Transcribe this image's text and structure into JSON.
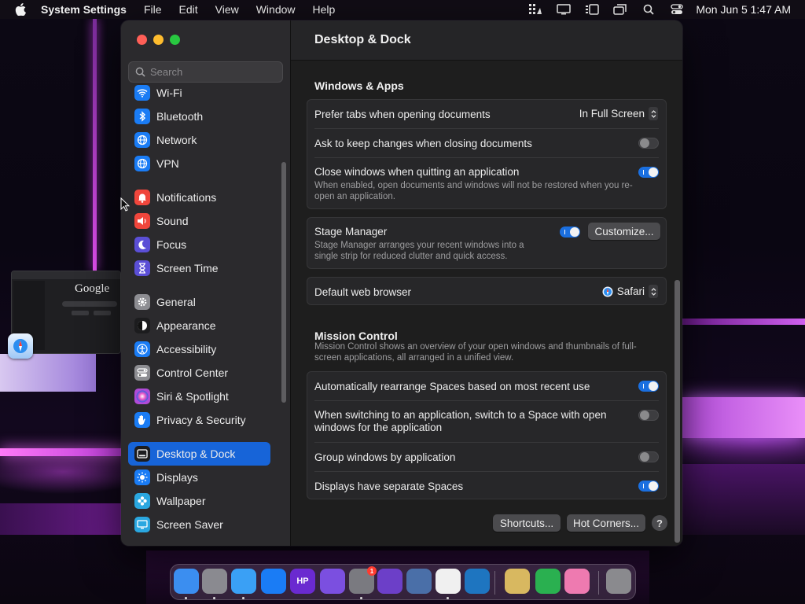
{
  "menubar": {
    "app_name": "System Settings",
    "menus": [
      "File",
      "Edit",
      "View",
      "Window",
      "Help"
    ],
    "clock": "Mon Jun 5  1:47 AM"
  },
  "stage_thumbnail": {
    "label": "Google"
  },
  "window": {
    "search": {
      "placeholder": "Search"
    },
    "sidebar": {
      "items": [
        {
          "label": "Wi-Fi",
          "icon": "wifi-icon",
          "color": "#1a7cf5"
        },
        {
          "label": "Bluetooth",
          "icon": "bluetooth-icon",
          "color": "#1a7cf5"
        },
        {
          "label": "Network",
          "icon": "globe-icon",
          "color": "#1a7cf5"
        },
        {
          "label": "VPN",
          "icon": "globe-icon",
          "color": "#1a7cf5"
        },
        {
          "label": "Notifications",
          "icon": "bell-icon",
          "color": "#f0463c"
        },
        {
          "label": "Sound",
          "icon": "speaker-icon",
          "color": "#f0463c"
        },
        {
          "label": "Focus",
          "icon": "moon-icon",
          "color": "#5b4fd6"
        },
        {
          "label": "Screen Time",
          "icon": "hourglass-icon",
          "color": "#5b4fd6"
        },
        {
          "label": "General",
          "icon": "gear-icon",
          "color": "#8d8d92"
        },
        {
          "label": "Appearance",
          "icon": "appearance-icon",
          "color": "#1c1c1e"
        },
        {
          "label": "Accessibility",
          "icon": "accessibility-icon",
          "color": "#1a7cf5"
        },
        {
          "label": "Control Center",
          "icon": "control-center-icon",
          "color": "#8d8d92"
        },
        {
          "label": "Siri & Spotlight",
          "icon": "siri-icon",
          "color": "#b04bd8"
        },
        {
          "label": "Privacy & Security",
          "icon": "hand-icon",
          "color": "#1a7cf5"
        },
        {
          "label": "Desktop & Dock",
          "icon": "dock-icon",
          "color": "#1c1c1e"
        },
        {
          "label": "Displays",
          "icon": "sun-icon",
          "color": "#1a7cf5"
        },
        {
          "label": "Wallpaper",
          "icon": "flower-icon",
          "color": "#2aa7e0"
        },
        {
          "label": "Screen Saver",
          "icon": "screen-saver-icon",
          "color": "#2aa7e0"
        }
      ],
      "active": "Desktop & Dock"
    },
    "title": "Desktop & Dock",
    "windows_apps": {
      "title": "Windows & Apps",
      "prefer_tabs": {
        "label": "Prefer tabs when opening documents",
        "value": "In Full Screen"
      },
      "ask_keep": {
        "label": "Ask to keep changes when closing documents",
        "on": false
      },
      "close_windows": {
        "label": "Close windows when quitting an application",
        "description": "When enabled, open documents and windows will not be restored when you re-open an application.",
        "on": true
      }
    },
    "stage_manager": {
      "label": "Stage Manager",
      "description": "Stage Manager arranges your recent windows into a single strip for reduced clutter and quick access.",
      "on": true,
      "customize_label": "Customize..."
    },
    "default_browser": {
      "label": "Default web browser",
      "value": "Safari"
    },
    "mission_control": {
      "title": "Mission Control",
      "description": "Mission Control shows an overview of your open windows and thumbnails of full-screen applications, all arranged in a unified view.",
      "rearrange": {
        "label": "Automatically rearrange Spaces based on most recent use",
        "on": true
      },
      "switch_space": {
        "label": "When switching to an application, switch to a Space with open windows for the application",
        "on": false
      },
      "group_windows": {
        "label": "Group windows by application",
        "on": false
      },
      "separate_spaces": {
        "label": "Displays have separate Spaces",
        "on": true
      }
    },
    "footer": {
      "shortcuts_label": "Shortcuts...",
      "hot_corners_label": "Hot Corners...",
      "help_label": "?"
    }
  },
  "dock": {
    "apps": [
      {
        "name": "finder-icon",
        "color": "#3b8ef0"
      },
      {
        "name": "launchpad-icon",
        "color": "#8a8a90"
      },
      {
        "name": "safari-icon",
        "color": "#3aa0f5"
      },
      {
        "name": "app-store-icon",
        "color": "#1a7cf5"
      },
      {
        "name": "hp-icon",
        "color": "#6a2ad0",
        "text": "HP"
      },
      {
        "name": "purple-app-icon",
        "color": "#7b4fe0"
      },
      {
        "name": "system-settings-icon",
        "color": "#7a7a80",
        "badge": "1"
      },
      {
        "name": "visual-studio-icon",
        "color": "#6c3fc8"
      },
      {
        "name": "xcode-icon",
        "color": "#4a6fa8"
      },
      {
        "name": "book-app-icon",
        "color": "#f0f0f0"
      },
      {
        "name": "vscode-icon",
        "color": "#1e75c0"
      },
      {
        "name": "archive-icon",
        "color": "#d8b860"
      },
      {
        "name": "tile-app-icon",
        "color": "#2ab050"
      },
      {
        "name": "pink-app-icon",
        "color": "#ee7ab0"
      },
      {
        "name": "trash-icon",
        "color": "#8a8a8e"
      }
    ]
  },
  "colors": {
    "accent": "#1764d8",
    "toggle_on": "#1a6fe0"
  }
}
